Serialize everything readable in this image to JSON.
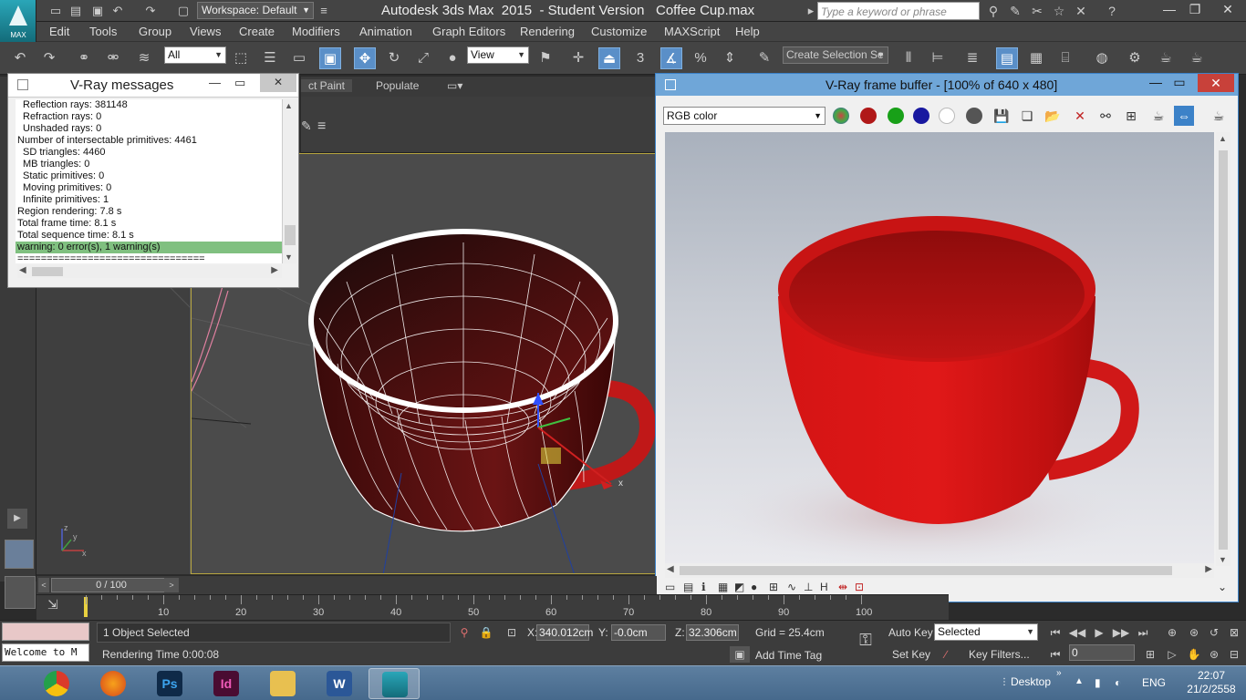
{
  "app": {
    "logo_text": "MAX",
    "title": "Autodesk 3ds Max  2015  - Student Version   Coffee Cup.max",
    "workspace": "Workspace: Default",
    "search_placeholder": "Type a keyword or phrase"
  },
  "menu": [
    "Edit",
    "Tools",
    "Group",
    "Views",
    "Create",
    "Modifiers",
    "Animation",
    "Graph Editors",
    "Rendering",
    "Customize",
    "MAXScript",
    "Help"
  ],
  "toolbar": {
    "filter": "All",
    "ref_coord": "View",
    "snap_label": "3",
    "selection_set": "Create Selection Se"
  },
  "ribbon": {
    "tabs": [
      "ct Paint",
      "Populate"
    ]
  },
  "vray_messages": {
    "title": "V-Ray messages",
    "lines": [
      {
        "text": "Reflection rays: 381148",
        "indent": true,
        "warn": false
      },
      {
        "text": "Refraction rays: 0",
        "indent": true,
        "warn": false
      },
      {
        "text": "Unshaded rays: 0",
        "indent": true,
        "warn": false
      },
      {
        "text": "Number of intersectable primitives: 4461",
        "indent": false,
        "warn": false
      },
      {
        "text": "SD triangles: 4460",
        "indent": true,
        "warn": false
      },
      {
        "text": "MB triangles: 0",
        "indent": true,
        "warn": false
      },
      {
        "text": "Static primitives: 0",
        "indent": true,
        "warn": false
      },
      {
        "text": "Moving primitives: 0",
        "indent": true,
        "warn": false
      },
      {
        "text": "Infinite primitives: 1",
        "indent": true,
        "warn": false
      },
      {
        "text": "Region rendering: 7.8 s",
        "indent": false,
        "warn": false
      },
      {
        "text": "Total frame time: 8.1 s",
        "indent": false,
        "warn": false
      },
      {
        "text": "Total sequence time: 8.1 s",
        "indent": false,
        "warn": false
      },
      {
        "text": "warning: 0 error(s), 1 warning(s)",
        "indent": false,
        "warn": true
      },
      {
        "text": "================================",
        "indent": false,
        "warn": false
      }
    ]
  },
  "frame_buffer": {
    "title": "V-Ray frame buffer - [100% of 640 x 480]",
    "channel": "RGB color"
  },
  "viewport": {
    "axis_x": "x",
    "axis_y": "y",
    "axis_z": "z"
  },
  "timeline": {
    "slider": "0 / 100",
    "ticks": [
      "10",
      "20",
      "30",
      "40",
      "50",
      "60",
      "70",
      "80",
      "90",
      "100"
    ]
  },
  "status": {
    "selection": "1 Object Selected",
    "render_time": "Rendering Time  0:00:08",
    "welcome": "Welcome to M",
    "x_label": "X:",
    "x_value": "340.012cm",
    "y_label": "Y:",
    "y_value": "-0.0cm",
    "z_label": "Z:",
    "z_value": "32.306cm",
    "grid": "Grid = 25.4cm",
    "add_time_tag": "Add Time Tag",
    "auto_key": "Auto Key",
    "key_mode": "Selected",
    "set_key": "Set Key",
    "key_filters": "Key Filters...",
    "frame": "0"
  },
  "taskbar": {
    "apps": [
      "Chrome",
      "Firefox",
      "Ps",
      "Id",
      "File Explorer",
      "W",
      "3ds Max"
    ],
    "desktop": "Desktop",
    "lang": "ENG",
    "time": "22:07",
    "date": "21/2/2558"
  }
}
